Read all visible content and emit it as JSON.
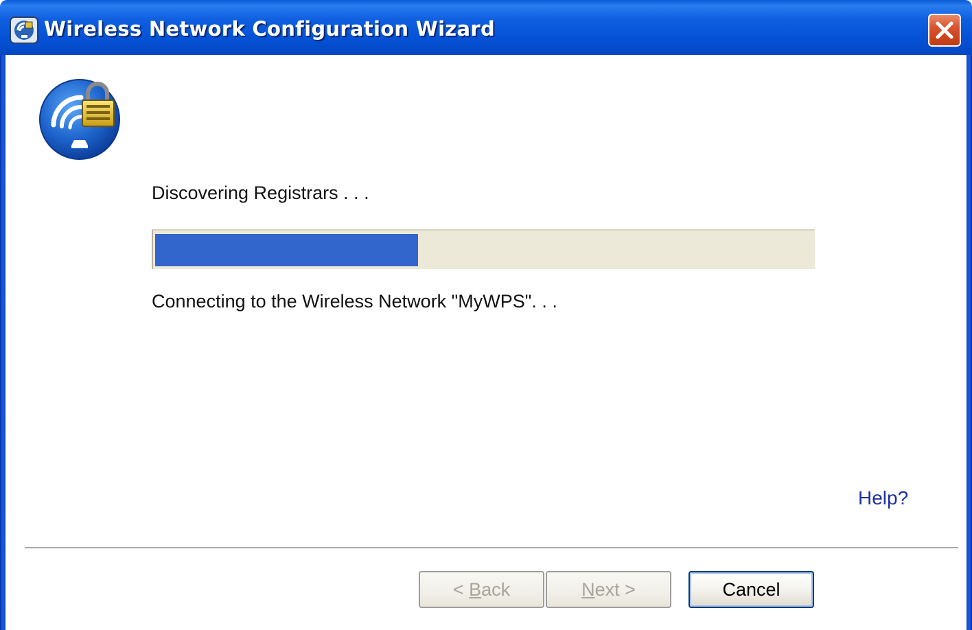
{
  "window": {
    "title": "Wireless Network Configuration Wizard",
    "title_icon": "wireless-wizard-icon",
    "close_icon": "close-icon"
  },
  "logo": {
    "icon": "wireless-lock-icon"
  },
  "status": {
    "label": "Discovering Registrars . . .",
    "progress": 0.4,
    "message": "Connecting to the Wireless Network \"MyWPS\". . ."
  },
  "help": {
    "label": "Help?"
  },
  "buttons": {
    "back": {
      "prefix": "< ",
      "mnemonic": "B",
      "rest": "ack",
      "enabled": false
    },
    "next": {
      "mnemonic": "N",
      "rest": "ext",
      "suffix": " >",
      "enabled": false
    },
    "cancel": {
      "label": "Cancel",
      "enabled": true
    }
  },
  "colors": {
    "titlebar": "#0552d6",
    "progress_fill": "#3366cc",
    "progress_track": "#ece9d8",
    "help_link": "#1c2fa3"
  }
}
